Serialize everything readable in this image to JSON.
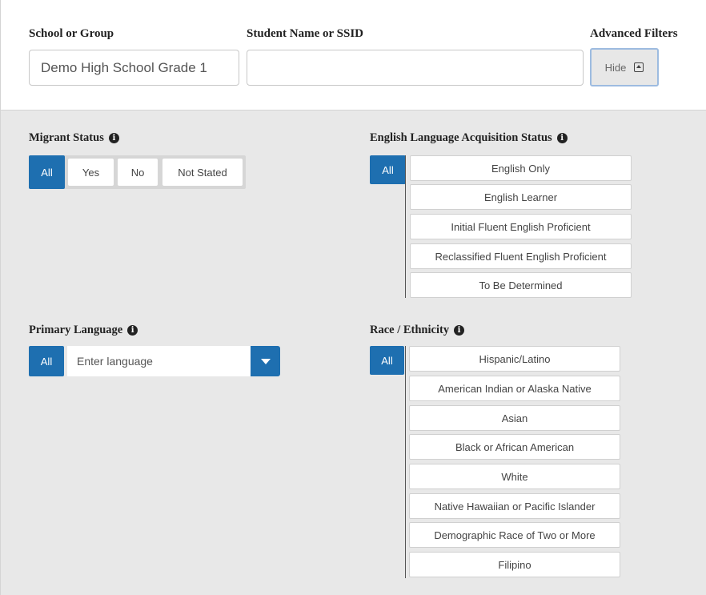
{
  "filters": {
    "school_label": "School or Group",
    "school_value": "Demo High School Grade 1",
    "student_label": "Student Name or SSID",
    "student_value": "",
    "advanced_label": "Advanced Filters",
    "hide_label": "Hide"
  },
  "migrant": {
    "title": "Migrant Status",
    "options": [
      "All",
      "Yes",
      "No",
      "Not Stated"
    ]
  },
  "ela": {
    "title": "English Language Acquisition Status",
    "all": "All",
    "options": [
      "English Only",
      "English Learner",
      "Initial Fluent English Proficient",
      "Reclassified Fluent English Proficient",
      "To Be Determined"
    ]
  },
  "language": {
    "title": "Primary Language",
    "all": "All",
    "placeholder": "Enter language"
  },
  "race": {
    "title": "Race / Ethnicity",
    "all": "All",
    "options": [
      "Hispanic/Latino",
      "American Indian or Alaska Native",
      "Asian",
      "Black or African American",
      "White",
      "Native Hawaiian or Pacific Islander",
      "Demographic Race of Two or More",
      "Filipino"
    ]
  },
  "colors": {
    "primary": "#1e6fb0",
    "panel_bg": "#e8e8e8"
  }
}
